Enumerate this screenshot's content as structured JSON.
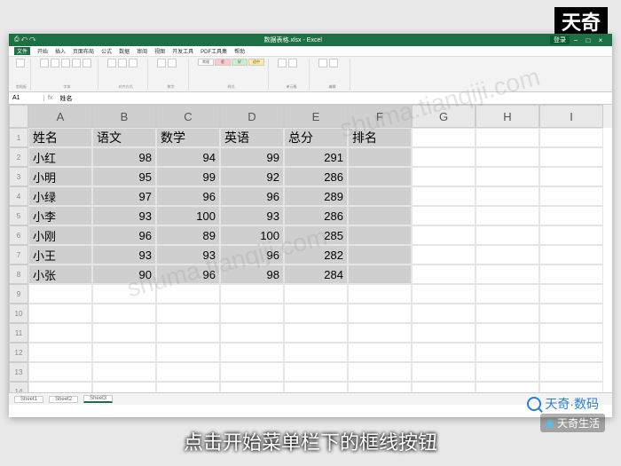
{
  "top_brand": "天奇",
  "titlebar": {
    "filename": "数据表格.xlsx",
    "app": "Excel",
    "signin": "登录"
  },
  "menu": [
    "文件",
    "开始",
    "插入",
    "页面布局",
    "公式",
    "数据",
    "审阅",
    "视图",
    "开发工具",
    "PDF工具集",
    "帮助"
  ],
  "ribbon_labels": {
    "clipboard": "剪贴板",
    "font": "字体",
    "align": "对齐方式",
    "number": "数字",
    "styles": "样式",
    "cells": "单元格",
    "editing": "编辑"
  },
  "style_names": [
    "常规",
    "差",
    "好",
    "适中"
  ],
  "formula": {
    "namebox": "A1",
    "value": "姓名"
  },
  "columns": [
    "A",
    "B",
    "C",
    "D",
    "E",
    "F",
    "G",
    "H",
    "I"
  ],
  "sel_cols": 6,
  "chart_data": {
    "type": "table",
    "headers": [
      "姓名",
      "语文",
      "数学",
      "英语",
      "总分",
      "排名"
    ],
    "rows": [
      [
        "小红",
        98,
        94,
        99,
        291,
        ""
      ],
      [
        "小明",
        95,
        99,
        92,
        286,
        ""
      ],
      [
        "小绿",
        97,
        96,
        96,
        289,
        ""
      ],
      [
        "小李",
        93,
        100,
        93,
        286,
        ""
      ],
      [
        "小刚",
        96,
        89,
        100,
        285,
        ""
      ],
      [
        "小王",
        93,
        93,
        96,
        282,
        ""
      ],
      [
        "小张",
        90,
        96,
        98,
        284,
        ""
      ]
    ]
  },
  "blank_rows": 6,
  "sheets": [
    "Sheet1",
    "Sheet2",
    "Sheet3"
  ],
  "active_sheet": 2,
  "caption": "点击开始菜单栏下的框线按钮",
  "brand_bottom": "天奇·数码",
  "brand_life": "天奇生活",
  "watermark": "shuma.tianqiji.com"
}
